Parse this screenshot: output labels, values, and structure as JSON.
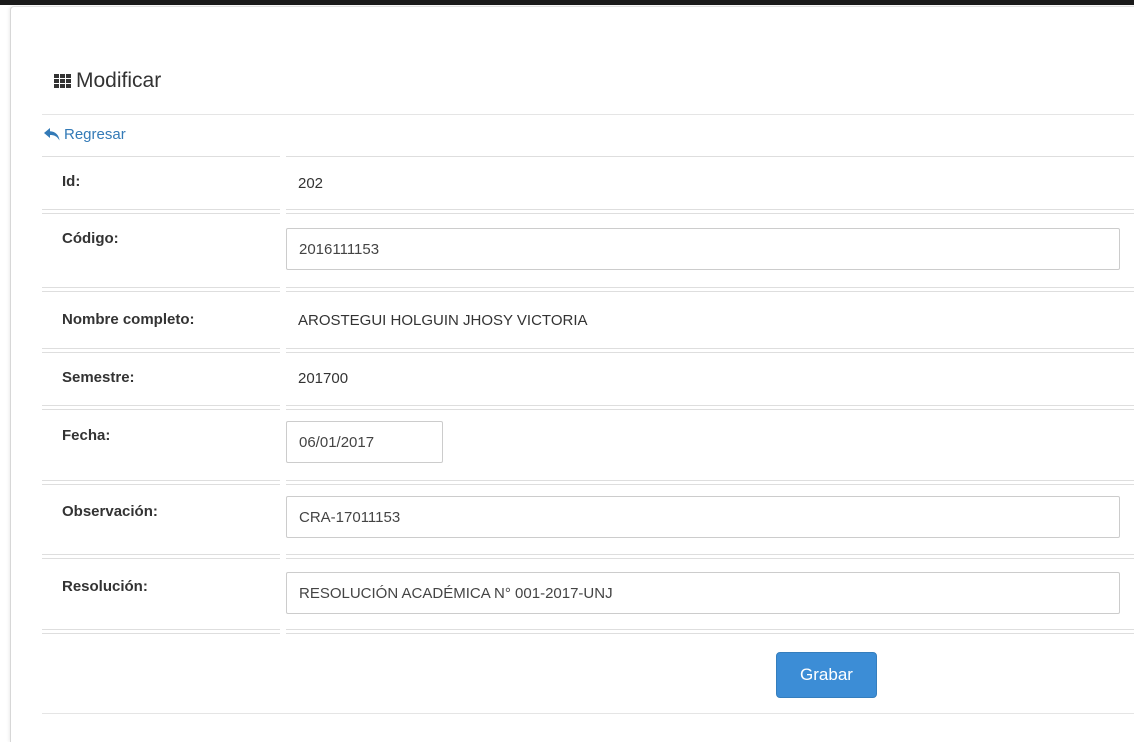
{
  "header": {
    "title": "Modificar",
    "title_icon": "th-grid-icon"
  },
  "back_link": {
    "label": "Regresar",
    "icon": "reply-arrow-icon"
  },
  "form": {
    "id": {
      "label": "Id:",
      "value": "202"
    },
    "codigo": {
      "label": "Código:",
      "value": "2016111153"
    },
    "nombre": {
      "label": "Nombre completo:",
      "value": "AROSTEGUI HOLGUIN JHOSY VICTORIA"
    },
    "semestre": {
      "label": "Semestre:",
      "value": "201700"
    },
    "fecha": {
      "label": "Fecha:",
      "value": "06/01/2017"
    },
    "observacion": {
      "label": "Observación:",
      "value": "CRA-17011153"
    },
    "resolucion": {
      "label": "Resolución:",
      "value": "RESOLUCIÓN ACADÉMICA N° 001-2017-UNJ"
    }
  },
  "actions": {
    "save_label": "Grabar"
  },
  "colors": {
    "link": "#337ab7",
    "primary_button": "#3c8dd6"
  }
}
